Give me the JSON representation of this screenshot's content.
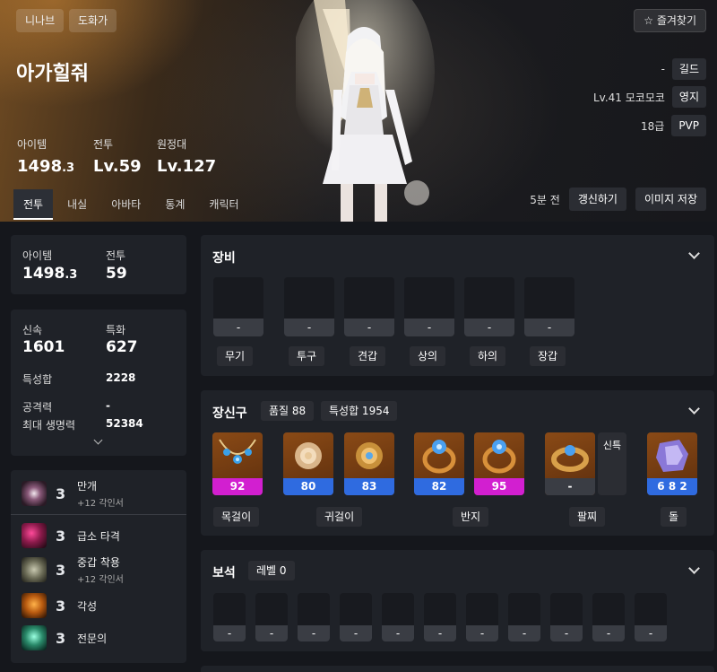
{
  "header": {
    "server_tag": "니나브",
    "class_tag": "도화가",
    "character_name": "아가힐줘",
    "favorite_label": "즐겨찾기",
    "stats": [
      {
        "label": "아이템",
        "value": "1498",
        "decimal": ".3"
      },
      {
        "label": "전투",
        "value": "Lv.59"
      },
      {
        "label": "원정대",
        "value": "Lv.127"
      }
    ],
    "guild": {
      "value": "-",
      "tag": "길드"
    },
    "estate": {
      "value": "Lv.41 모코모코",
      "tag": "영지"
    },
    "pvp": {
      "value": "18급",
      "tag": "PVP"
    },
    "tabs": [
      "전투",
      "내실",
      "아바타",
      "통계",
      "캐릭터"
    ],
    "active_tab": "전투",
    "updated": "5분 전",
    "refresh_label": "갱신하기",
    "save_image_label": "이미지 저장"
  },
  "summary": {
    "item_label": "아이템",
    "item_value": "1498",
    "item_decimal": ".3",
    "combat_label": "전투",
    "combat_value": "59"
  },
  "stats_card": {
    "swift_label": "신속",
    "swift_value": "1601",
    "crit_label": "특화",
    "crit_value": "627",
    "total_label": "특성합",
    "total_value": "2228",
    "attack_label": "공격력",
    "attack_value": "-",
    "hp_label": "최대 생명력",
    "hp_value": "52384"
  },
  "engravings": [
    {
      "level": "3",
      "name": "만개",
      "sub": "+12 각인서",
      "icon_color": "#6b3a5a"
    },
    {
      "level": "3",
      "name": "급소 타격",
      "sub": "",
      "icon_color": "#8a1a4a"
    },
    {
      "level": "3",
      "name": "중갑 착용",
      "sub": "+12 각인서",
      "icon_color": "#4a4f3a"
    },
    {
      "level": "3",
      "name": "각성",
      "sub": "",
      "icon_color": "#9a5a1a"
    },
    {
      "level": "3",
      "name": "전문의",
      "sub": "",
      "icon_color": "#2a6a5a"
    }
  ],
  "equipment": {
    "title": "장비",
    "slots": [
      {
        "label": "무기",
        "value": "-"
      },
      {
        "label": "투구",
        "value": "-"
      },
      {
        "label": "견갑",
        "value": "-"
      },
      {
        "label": "상의",
        "value": "-"
      },
      {
        "label": "하의",
        "value": "-"
      },
      {
        "label": "장갑",
        "value": "-"
      }
    ]
  },
  "accessories": {
    "title": "장신구",
    "quality_badge": "품질 88",
    "stat_badge": "특성합 1954",
    "items": [
      {
        "value": "92",
        "bar_color": "#d21fd0",
        "icon": "necklace-icon"
      },
      {
        "value": "80",
        "bar_color": "#2f6be0",
        "icon": "earring-icon"
      },
      {
        "value": "83",
        "bar_color": "#2f6be0",
        "icon": "earring-icon"
      },
      {
        "value": "82",
        "bar_color": "#2f6be0",
        "icon": "ring-icon"
      },
      {
        "value": "95",
        "bar_color": "#d21fd0",
        "icon": "ring-icon"
      },
      {
        "value": "-",
        "bar_color": "#3a3d44",
        "icon": "bracelet-icon"
      },
      {
        "value": "6 8 2",
        "bar_color": "#2f6be0",
        "icon": "stone-icon"
      }
    ],
    "bracelet_extra": "신특",
    "groups": [
      "목걸이",
      "귀걸이",
      "반지",
      "팔찌",
      "돌"
    ]
  },
  "gems": {
    "title": "보석",
    "level_badge": "레벨 0",
    "values": [
      "-",
      "-",
      "-",
      "-",
      "-",
      "-",
      "-",
      "-",
      "-",
      "-",
      "-"
    ]
  }
}
